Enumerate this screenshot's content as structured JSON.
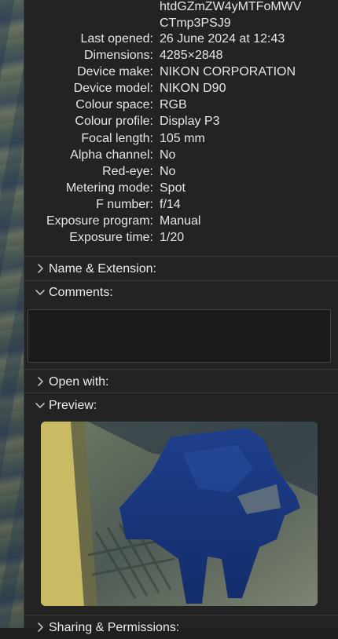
{
  "panel": {
    "title_continuation": [
      "htdGZmZW4yMTFoMWV",
      "CTmp3PSJ9"
    ],
    "metadata": [
      {
        "key": "Last opened:",
        "value": "26 June 2024 at 12:43"
      },
      {
        "key": "Dimensions:",
        "value": "4285×2848"
      },
      {
        "key": "Device make:",
        "value": "NIKON CORPORATION"
      },
      {
        "key": "Device model:",
        "value": "NIKON D90"
      },
      {
        "key": "Colour space:",
        "value": "RGB"
      },
      {
        "key": "Colour profile:",
        "value": "Display P3"
      },
      {
        "key": "Focal length:",
        "value": "105 mm"
      },
      {
        "key": "Alpha channel:",
        "value": "No"
      },
      {
        "key": "Red-eye:",
        "value": "No"
      },
      {
        "key": "Metering mode:",
        "value": "Spot"
      },
      {
        "key": "F number:",
        "value": "f/14"
      },
      {
        "key": "Exposure program:",
        "value": "Manual"
      },
      {
        "key": "Exposure time:",
        "value": "1/20"
      }
    ],
    "sections": {
      "name_extension": {
        "label": "Name & Extension:",
        "expanded": false
      },
      "comments": {
        "label": "Comments:",
        "expanded": true,
        "text": ""
      },
      "open_with": {
        "label": "Open with:",
        "expanded": false
      },
      "preview": {
        "label": "Preview:",
        "expanded": true
      },
      "sharing": {
        "label": "Sharing & Permissions:",
        "expanded": false
      }
    }
  },
  "icons": {
    "collapsed": "chevron-right-icon",
    "expanded": "chevron-down-icon"
  },
  "colors": {
    "panel_bg": "#232323",
    "divider": "#3a3a3a",
    "text": "#e6e6e6"
  }
}
